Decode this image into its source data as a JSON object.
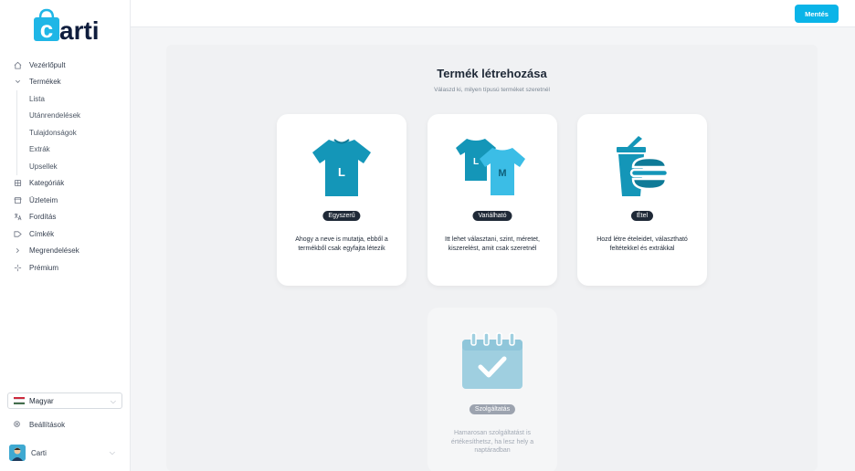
{
  "app": {
    "logo_text": "carti"
  },
  "sidebar": {
    "items": [
      {
        "label": "Vezérlőpult",
        "icon": "home-icon"
      },
      {
        "label": "Termékek",
        "icon": "chevron-down-icon"
      }
    ],
    "sub_items": [
      "Lista",
      "Utánrendelések",
      "Tulajdonságok",
      "Extrák",
      "Upsellek"
    ],
    "items_after": [
      {
        "label": "Kategóriák",
        "icon": "tag-grid-icon"
      },
      {
        "label": "Üzleteim",
        "icon": "store-icon"
      },
      {
        "label": "Fordítás",
        "icon": "translate-icon"
      },
      {
        "label": "Címkék",
        "icon": "label-icon"
      },
      {
        "label": "Megrendelések",
        "icon": "chevron-right-icon"
      },
      {
        "label": "Prémium",
        "icon": "sparkle-icon"
      }
    ],
    "language": "Magyar",
    "settings_label": "Beállítások",
    "user_name": "Carti"
  },
  "toolbar": {
    "save_label": "Mentés"
  },
  "main": {
    "title": "Termék létrehozása",
    "subtitle": "Válaszd ki, milyen típusú terméket szeretnél",
    "cards": [
      {
        "badge": "Egyszerű",
        "desc": "Ahogy a neve is mutatja, ebből a termékből csak egyfajta létezik",
        "icon": "tshirt-icon",
        "size_label": "L"
      },
      {
        "badge": "Variálható",
        "desc": "Itt lehet választani, szint, méretet, kiszerelést, amit csak szeretnél",
        "icon": "tshirts-icon",
        "size_labels": [
          "L",
          "M"
        ]
      },
      {
        "badge": "Étel",
        "desc": "Hozd létre ételeidet, választható feltétekkel és extrákkal",
        "icon": "food-icon"
      },
      {
        "badge": "Szolgáltatás",
        "desc": "Hamarosan szolgáltatást is értékesíthetsz, ha lesz hely a naptáradban",
        "icon": "calendar-check-icon",
        "disabled": true
      }
    ]
  },
  "colors": {
    "accent": "#0ab4e8",
    "shirt_dark": "#1496b8",
    "shirt_light": "#3bbde6",
    "disabled_icon": "#9fcfe0"
  }
}
